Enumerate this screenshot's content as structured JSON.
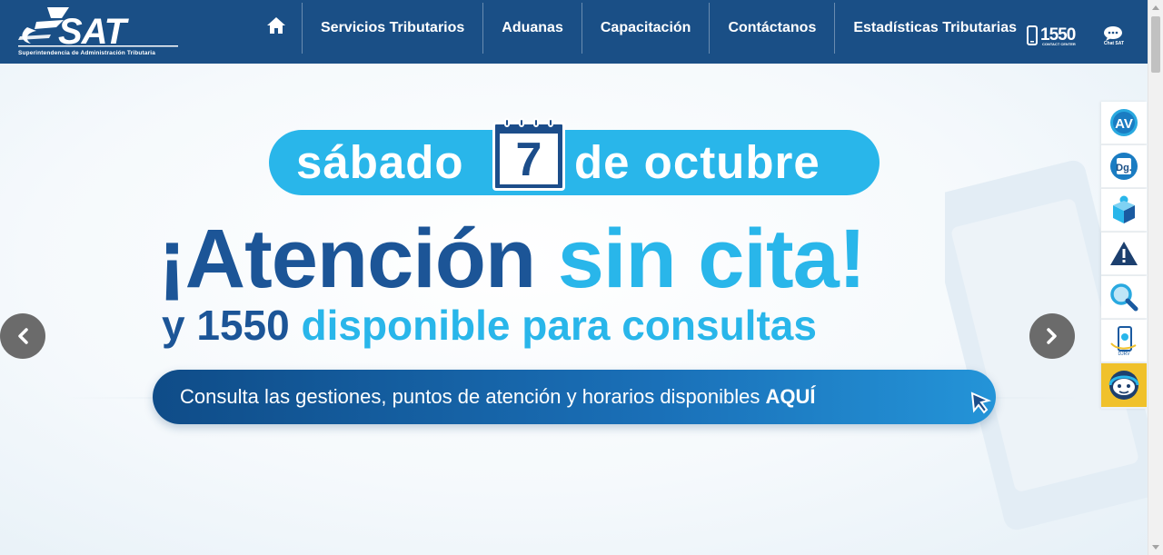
{
  "header": {
    "logo_text": "SAT",
    "logo_subtitle": "Superintendencia de Administración Tributaria",
    "nav_items": [
      {
        "label": "Servicios Tributarios"
      },
      {
        "label": "Aduanas"
      },
      {
        "label": "Capacitación"
      },
      {
        "label": "Contáctanos"
      },
      {
        "label": "Estadísticas Tributarias"
      }
    ],
    "contact_center": {
      "number": "1550",
      "label": "CONTACT CENTER"
    },
    "chat": {
      "label": "Chat SAT"
    }
  },
  "hero": {
    "date_prefix": "sábado",
    "date_day": "7",
    "date_suffix": "de octubre",
    "headline_dark": "¡Atención",
    "headline_light": "sin cita!",
    "subline_dark": "y 1550",
    "subline_light": "disponible para consultas",
    "cta_text": "Consulta las gestiones, puntos de atención y horarios disponibles",
    "cta_bold": "AQUÍ"
  },
  "side_links": [
    {
      "icon": "agencia-virtual-icon"
    },
    {
      "icon": "declaraguate-icon"
    },
    {
      "icon": "user-box-icon"
    },
    {
      "icon": "warning-icon"
    },
    {
      "icon": "search-icon"
    },
    {
      "icon": "mobile-app-icon"
    },
    {
      "icon": "chat-assistant-icon"
    }
  ],
  "colors": {
    "header_bg": "#1a4f86",
    "brand_dark": "#1c5597",
    "brand_light": "#29b6ea",
    "chat_yellow": "#f0c12b"
  }
}
